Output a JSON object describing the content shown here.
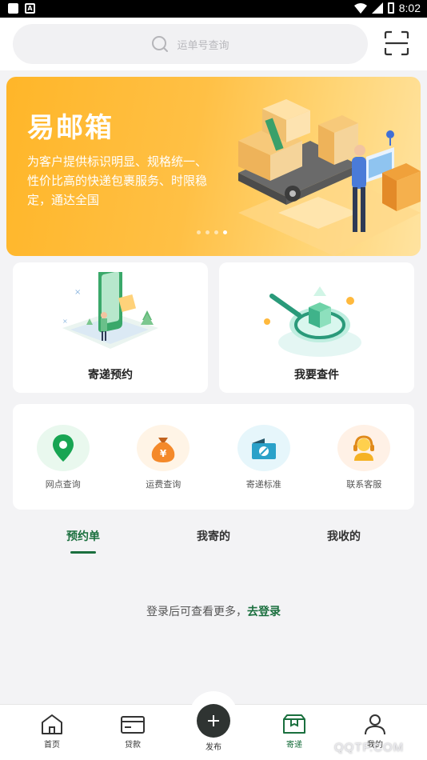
{
  "status_bar": {
    "time": "8:02"
  },
  "search": {
    "placeholder": "运单号查询"
  },
  "banner": {
    "title": "易邮箱",
    "description": "为客户提供标识明显、规格统一、性价比高的快递包裹服务、时限稳定，通达全国",
    "slide_count": 4,
    "active_slide": 4
  },
  "cards": [
    {
      "label": "寄递预约",
      "icon": "mailbox-phone-illustration"
    },
    {
      "label": "我要查件",
      "icon": "magnifier-package-illustration"
    }
  ],
  "services": [
    {
      "label": "网点查询",
      "icon": "location-pin-icon",
      "color": "#18a553"
    },
    {
      "label": "运费查询",
      "icon": "money-bag-icon",
      "color": "#f4892a"
    },
    {
      "label": "寄递标准",
      "icon": "box-standard-icon",
      "color": "#2aa1c9"
    },
    {
      "label": "联系客服",
      "icon": "headset-agent-icon",
      "color": "#f5b225"
    }
  ],
  "order_tabs": [
    {
      "label": "预约单",
      "active": true
    },
    {
      "label": "我寄的",
      "active": false
    },
    {
      "label": "我收的",
      "active": false
    }
  ],
  "login_tip": {
    "text": "登录后可查看更多，",
    "link": "去登录"
  },
  "tabbar": {
    "home": "首页",
    "loan": "贷款",
    "publish": "发布",
    "send": "寄递",
    "mine": "我的"
  },
  "watermark": "QQTF.COM",
  "colors": {
    "brand_green": "#1a6f3e",
    "banner_orange": "#ffb629"
  }
}
